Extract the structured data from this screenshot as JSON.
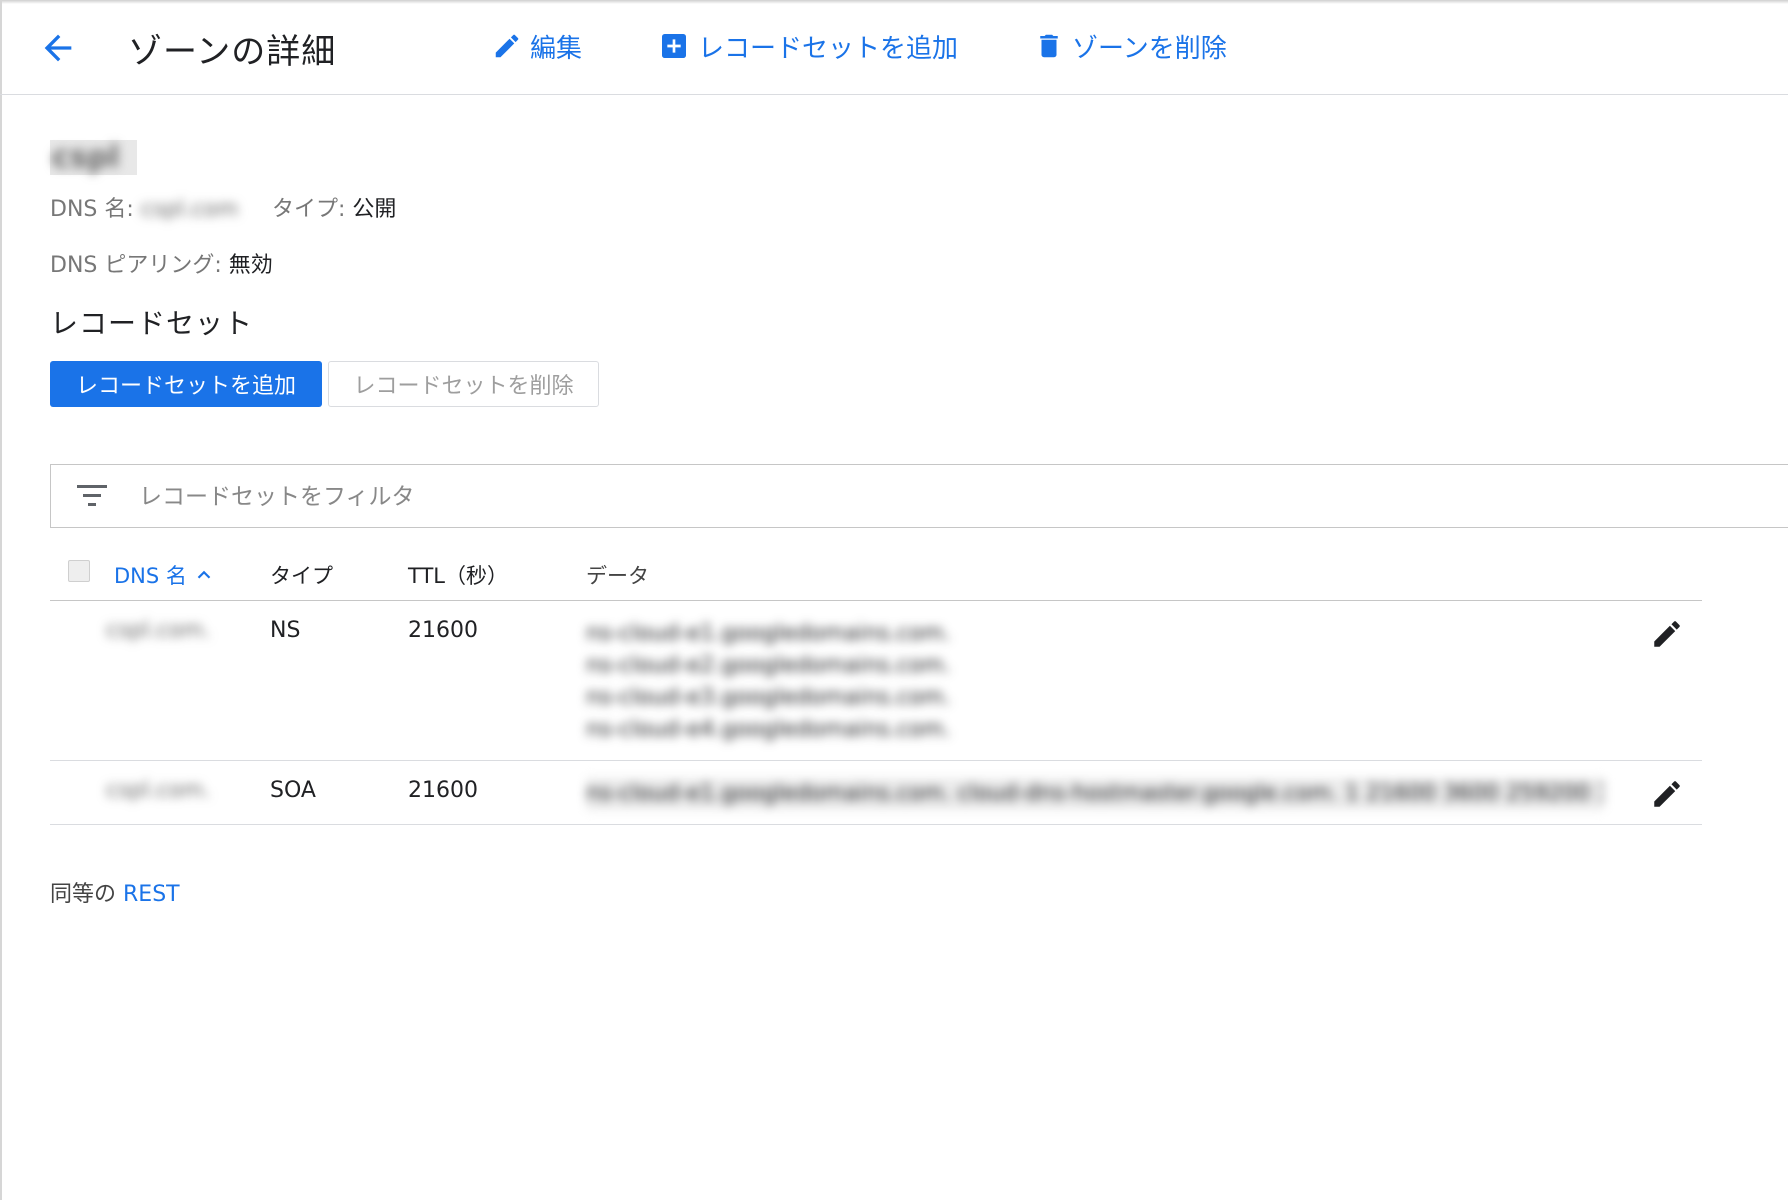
{
  "colors": {
    "accent": "#1a73e8",
    "divider": "#dadce0"
  },
  "header": {
    "title": "ゾーンの詳細",
    "back_icon": "arrow-back-icon",
    "actions": [
      {
        "label": "編集",
        "icon": "pencil-icon"
      },
      {
        "label": "レコードセットを追加",
        "icon": "add-box-icon"
      },
      {
        "label": "ゾーンを削除",
        "icon": "trash-icon"
      }
    ]
  },
  "zone": {
    "name": "cspl",
    "dns_name_label": "DNS 名:",
    "dns_name_value": "cspl.com",
    "type_label": "タイプ:",
    "type_value": "公開",
    "peering_label": "DNS ピアリング:",
    "peering_value": "無効"
  },
  "record_sets": {
    "title": "レコードセット",
    "add_button": "レコードセットを追加",
    "delete_button": "レコードセットを削除",
    "filter_placeholder": "レコードセットをフィルタ",
    "filter_icon": "filter-icon",
    "columns": {
      "dns_name": "DNS 名",
      "type": "タイプ",
      "ttl": "TTL（秒）",
      "data": "データ"
    },
    "rows": [
      {
        "dns_name": "cspl.com.",
        "type": "NS",
        "ttl": "21600",
        "data": [
          "ns-cloud-e1.googledomains.com.",
          "ns-cloud-e2.googledomains.com.",
          "ns-cloud-e3.googledomains.com.",
          "ns-cloud-e4.googledomains.com."
        ]
      },
      {
        "dns_name": "cspl.com.",
        "type": "SOA",
        "ttl": "21600",
        "data": [
          "ns-cloud-e1.googledomains.com. cloud-dns-hostmaster.google.com. 1 21600 3600 259200 300"
        ]
      }
    ]
  },
  "footer": {
    "prefix": "同等の",
    "link": "REST"
  }
}
